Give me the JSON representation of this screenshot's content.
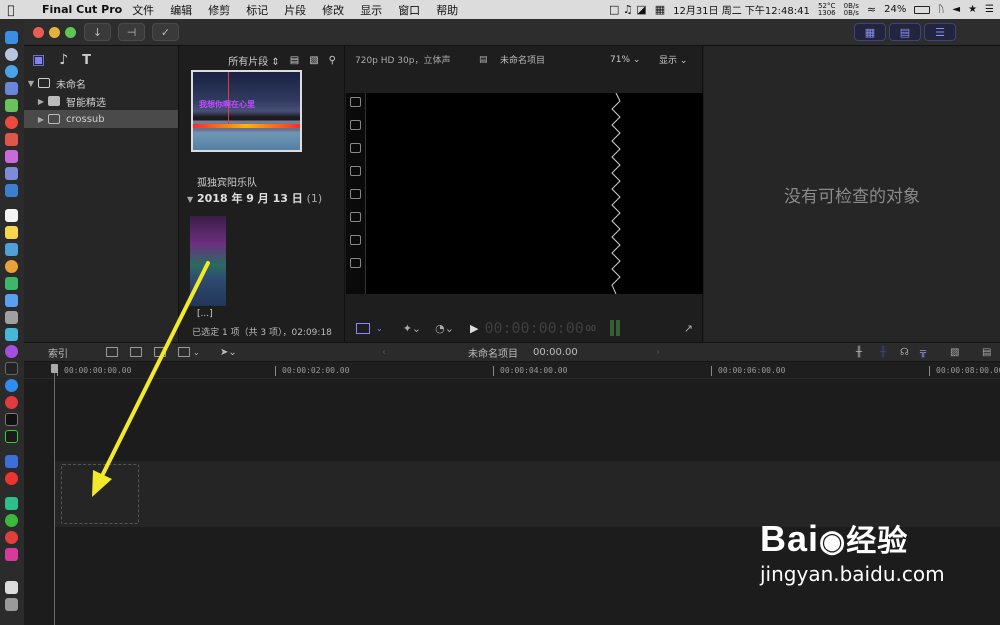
{
  "menubar": {
    "app_name": "Final Cut Pro",
    "items": [
      "文件",
      "编辑",
      "修剪",
      "标记",
      "片段",
      "修改",
      "显示",
      "窗口",
      "帮助"
    ],
    "cpu_temp": "52°C",
    "fan": "1306",
    "net_up": "0B/s",
    "net_down": "0B/s",
    "datetime": "12月31日 周二 下午12:48:41",
    "battery": "24%"
  },
  "sidebar": {
    "items": [
      {
        "label": "未命名",
        "expanded": true
      },
      {
        "label": "智能精选",
        "expanded": false
      },
      {
        "label": "crossub",
        "selected": true
      }
    ]
  },
  "browser": {
    "filter": "所有片段",
    "clip1_overlay": "我想你啊在心里",
    "clip1_name": "孤独宾阳乐队",
    "date_header": "2018 年 9 月 13 日",
    "date_count": "(1)",
    "clip2_name": "[...]",
    "selection_info": "已选定 1 项（共 3 项），02:09:18"
  },
  "viewer": {
    "format": "720p HD 30p，立体声",
    "project_name": "未命名项目",
    "zoom": "71%",
    "display_menu": "显示",
    "timecode": "00:00:00:00",
    "timecode_suffix": "00"
  },
  "inspector": {
    "empty_message": "没有可检查的对象"
  },
  "timeline": {
    "index_label": "索引",
    "project_name": "未命名项目",
    "current_time": "00:00.00",
    "ticks": [
      "00:00:00:00.00",
      "00:00:02:00.00",
      "00:00:04:00.00",
      "00:00:06:00.00",
      "00:00:08:00.00"
    ]
  },
  "watermark": {
    "brand": "Bai",
    "brand_tail": "经验",
    "url": "jingyan.baidu.com"
  },
  "colors": {
    "accent": "#8a8ef0",
    "arrow": "#f2e92a"
  }
}
